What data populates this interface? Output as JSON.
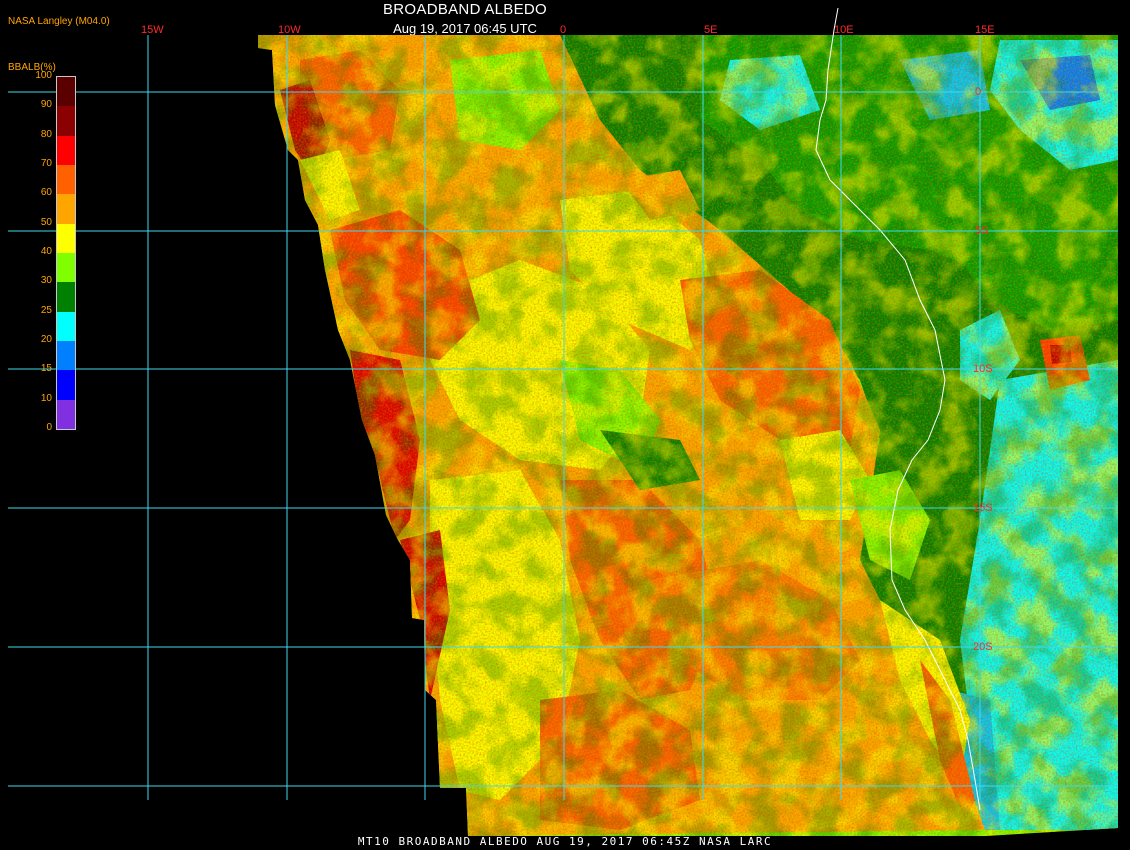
{
  "header": {
    "title": "BROADBAND ALBEDO",
    "datetime": "Aug 19, 2017 06:45 UTC",
    "credit": "NASA Langley (M04.0)"
  },
  "footer": {
    "text": "MT10  BROADBAND ALBEDO   AUG 19, 2017 06:45Z   NASA LARC"
  },
  "legend": {
    "title": "BBALB(%)",
    "ticks": [
      "100",
      "90",
      "80",
      "70",
      "60",
      "50",
      "40",
      "30",
      "25",
      "20",
      "15",
      "10",
      "0"
    ],
    "colors": [
      "#5a0000",
      "#8b0000",
      "#ff0000",
      "#ff6000",
      "#ffa500",
      "#ffff00",
      "#80ff00",
      "#008000",
      "#00ffff",
      "#0080ff",
      "#0000ff",
      "#8030e0"
    ]
  },
  "map": {
    "longitude_labels": [
      "15W",
      "10W",
      "0",
      "5E",
      "10E",
      "15E"
    ],
    "latitude_labels": [
      "0",
      "5S",
      "10S",
      "15S",
      "20S"
    ],
    "grid_color": "#40d8e8",
    "no_data_color": "#000000"
  }
}
